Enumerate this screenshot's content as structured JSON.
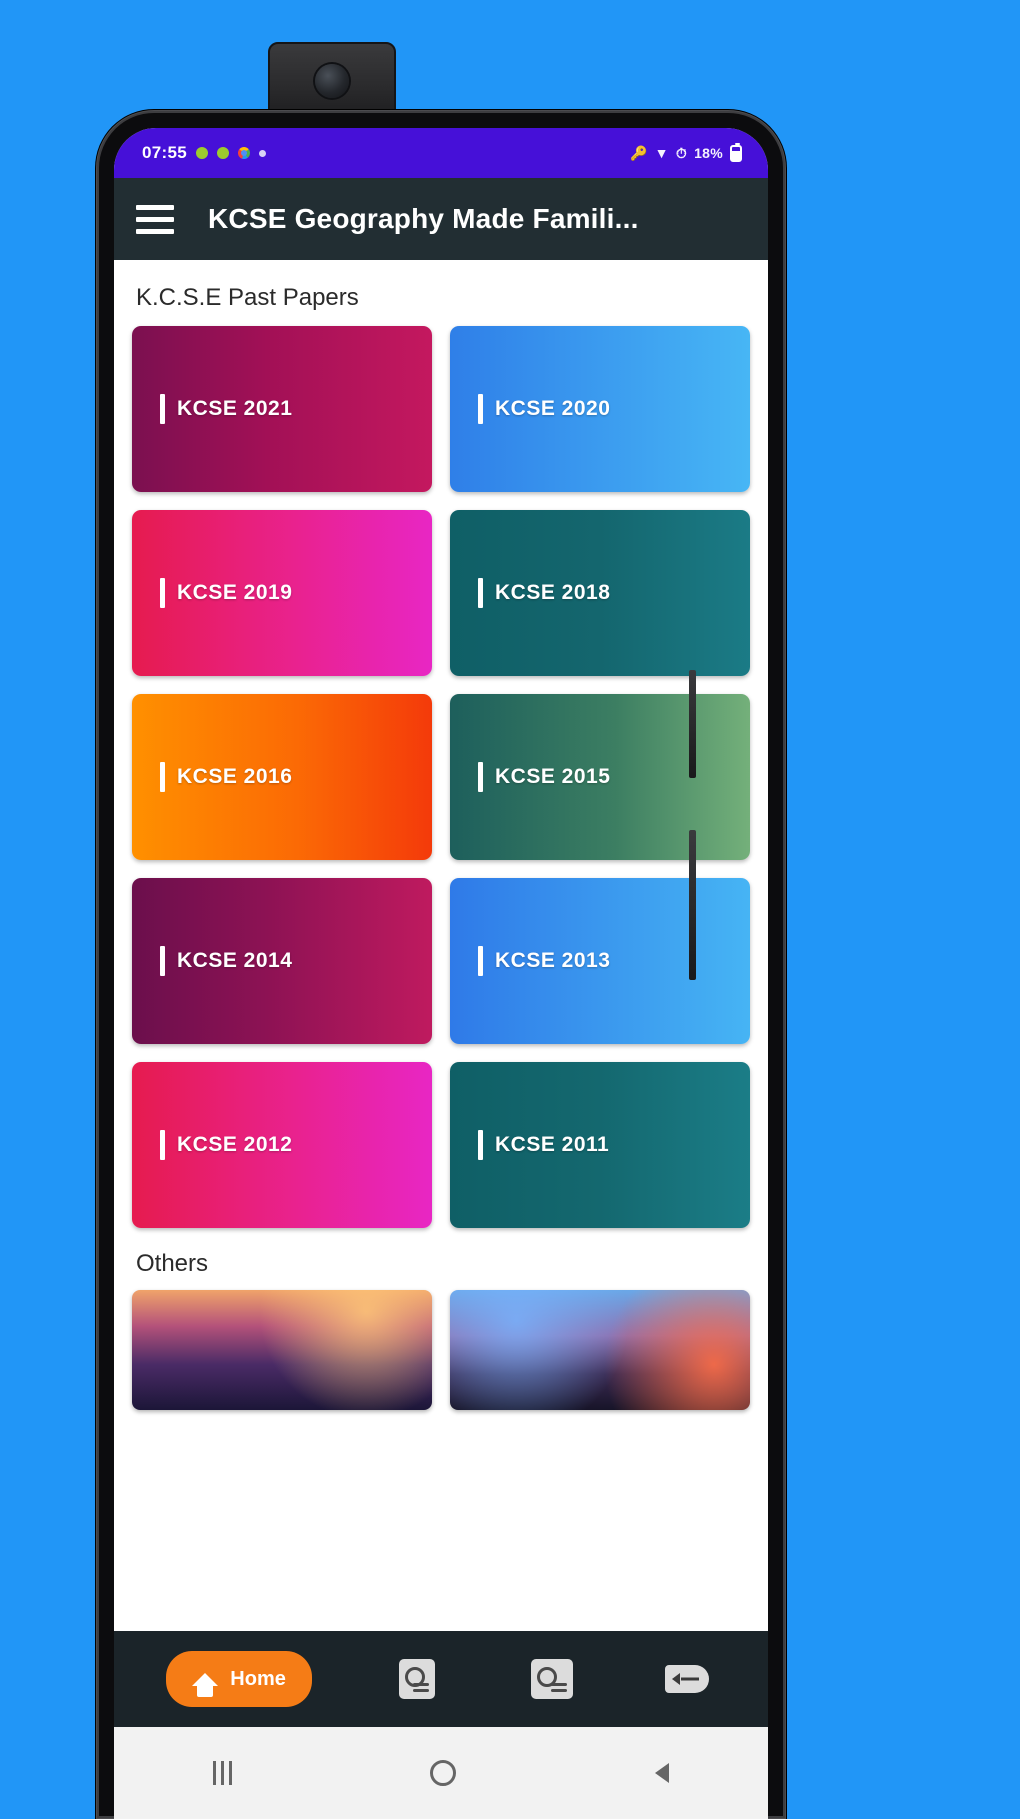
{
  "status_bar": {
    "time": "07:55",
    "left_icons": [
      "green-dot-icon",
      "green-dot-icon",
      "chrome-icon",
      "small-dot-icon"
    ],
    "right_icons": [
      "vpn-key-icon",
      "wifi-icon",
      "alarm-icon",
      "battery-icon"
    ],
    "battery_text": "18%",
    "background_color": "#4610d8"
  },
  "appbar": {
    "menu_icon": "hamburger-menu-icon",
    "title": "KCSE Geography Made Famili...",
    "background_color": "#222e33"
  },
  "main": {
    "past_papers_heading": "K.C.S.E Past Papers",
    "cards": [
      {
        "label": "KCSE 2021",
        "gradient": "linear-gradient(90deg,#7b1050 0%,#a21056 45%,#c4185f 100%)"
      },
      {
        "label": "KCSE 2020",
        "gradient": "linear-gradient(90deg,#2f7fe8 0%,#3b9bef 50%,#47b6f5 100%)"
      },
      {
        "label": "KCSE 2019",
        "gradient": "linear-gradient(90deg,#e61b4f 0%,#e9228f 55%,#e826c4 100%)"
      },
      {
        "label": "KCSE 2018",
        "gradient": "linear-gradient(90deg,#0f5f66 0%,#14666e 50%,#1b7b86 100%)"
      },
      {
        "label": "KCSE 2016",
        "gradient": "linear-gradient(90deg,#ff9000 0%,#fb6a05 55%,#f43a0a 100%)"
      },
      {
        "label": "KCSE 2015",
        "gradient": "linear-gradient(90deg,#1d5f5c 0%,#3c7e62 55%,#74b07a 100%)"
      },
      {
        "label": "KCSE 2014",
        "gradient": "linear-gradient(90deg,#6b0f4c 0%,#8d1254 45%,#bf1a5f 100%)"
      },
      {
        "label": "KCSE 2013",
        "gradient": "linear-gradient(90deg,#2f7ae8 0%,#3a97ee 50%,#46b4f4 100%)"
      },
      {
        "label": "KCSE 2012",
        "gradient": "linear-gradient(90deg,#e61b4f 0%,#e9228f 55%,#e826c4 100%)"
      },
      {
        "label": "KCSE 2011",
        "gradient": "linear-gradient(90deg,#0f5f66 0%,#14686f 50%,#1b7d87 100%)"
      }
    ],
    "others_heading": "Others",
    "others_thumbnails": [
      "landscape-thumbnail-a",
      "landscape-thumbnail-b"
    ]
  },
  "bottom_nav": {
    "background_color": "#1b2429",
    "items": [
      {
        "label": "Home",
        "icon": "home-icon",
        "active": true
      },
      {
        "label": "",
        "icon": "notes-icon",
        "active": false
      },
      {
        "label": "",
        "icon": "book-icon",
        "active": false
      },
      {
        "label": "",
        "icon": "back-arrow-icon",
        "active": false
      }
    ],
    "active_color": "#f57c16"
  },
  "system_nav": {
    "recents": "recents-icon",
    "home": "home-circle-icon",
    "back": "back-chevron-icon"
  }
}
